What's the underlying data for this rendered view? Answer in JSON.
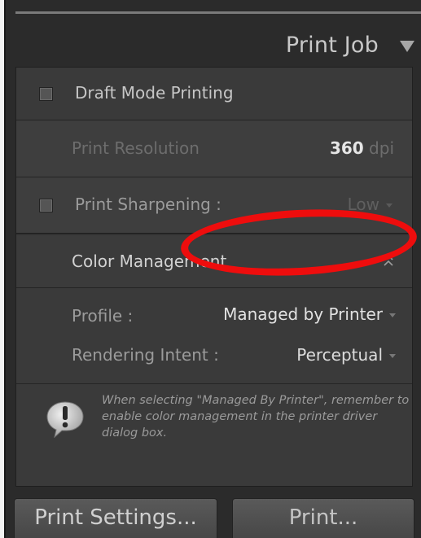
{
  "header": {
    "title": "Print Job"
  },
  "draft": {
    "label": "Draft Mode Printing"
  },
  "resolution": {
    "label": "Print Resolution",
    "value": "360",
    "unit": "dpi"
  },
  "sharpening": {
    "label": "Print Sharpening :",
    "value": "Low"
  },
  "color_management": {
    "title": "Color Management",
    "profile_label": "Profile :",
    "profile_value": "Managed by Printer",
    "intent_label": "Rendering Intent :",
    "intent_value": "Perceptual"
  },
  "info": {
    "text": "When selecting \"Managed By Printer\", remember to enable color management in the printer driver dialog box."
  },
  "buttons": {
    "print_settings": "Print Settings...",
    "print": "Print..."
  },
  "colors": {
    "panel": "#3a3a3a",
    "annotation_red": "#ee0d0d"
  }
}
